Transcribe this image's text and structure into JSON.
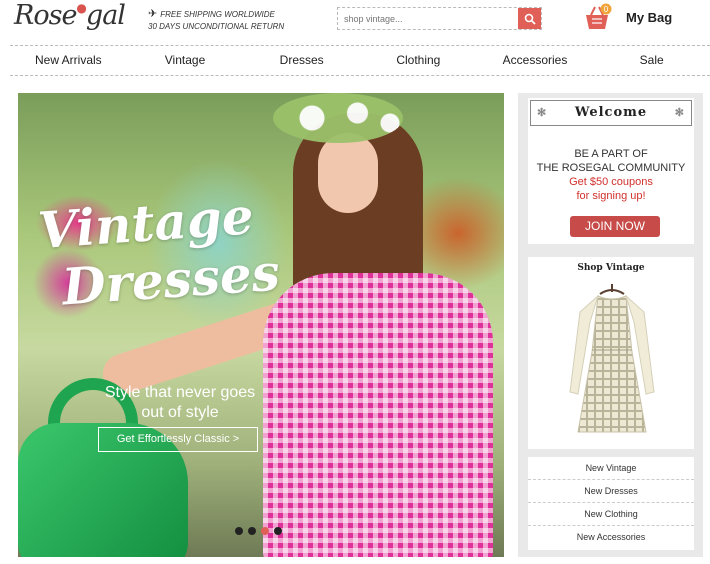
{
  "header": {
    "logo": "Rose",
    "logo_tail": "gal",
    "shipping_line1": "FREE SHIPPING WORLDWIDE",
    "shipping_line2": "30 DAYS UNCONDITIONAL RETURN",
    "search_placeholder": "shop vintage...",
    "bag_label": "My Bag",
    "bag_count": "0"
  },
  "nav": {
    "items": [
      "New Arrivals",
      "Vintage",
      "Dresses",
      "Clothing",
      "Accessories",
      "Sale"
    ]
  },
  "hero": {
    "title_line1": "Vintage",
    "title_line2": "Dresses",
    "subtitle_line1": "Style that never goes",
    "subtitle_line2": "out of style",
    "cta": "Get Effortlessly Classic  >",
    "slides_total": 4,
    "slide_active": 3
  },
  "sidebar": {
    "welcome_title": "Welcome",
    "welcome_line1": "BE A PART OF",
    "welcome_line2": "THE ROSEGAL COMMUNITY",
    "welcome_line3": "Get $50 coupons",
    "welcome_line4": "for signing up!",
    "join": "JOIN NOW",
    "shop_title": "Shop Vintage",
    "links": [
      "New Vintage",
      "New Dresses",
      "New Clothing",
      "New Accessories"
    ]
  },
  "colors": {
    "accent_red": "#e06057",
    "join_button": "#c64b49",
    "coupon_text": "#d0312d"
  },
  "icons": {
    "shipping": "plane-icon",
    "search": "search-icon",
    "bag": "shopping-basket-icon"
  }
}
